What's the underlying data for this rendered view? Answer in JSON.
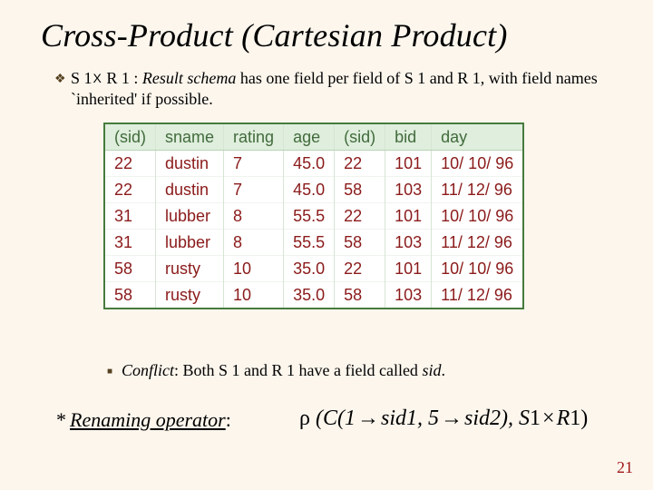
{
  "title": "Cross-Product (Cartesian Product)",
  "bullet1": {
    "pre": "S 1",
    "cross": "X",
    "post": " R 1 :  ",
    "result_schema": "Result schema",
    "tail": " has one field per field of S 1 and R 1, with field names `inherited' if possible."
  },
  "table": {
    "headers": [
      "(sid)",
      "sname",
      "rating",
      "age",
      "(sid)",
      "bid",
      "day"
    ],
    "rows": [
      [
        "22",
        "dustin",
        "7",
        "45.0",
        "22",
        "101",
        "10/ 10/ 96"
      ],
      [
        "22",
        "dustin",
        "7",
        "45.0",
        "58",
        "103",
        "11/ 12/ 96"
      ],
      [
        "31",
        "lubber",
        "8",
        "55.5",
        "22",
        "101",
        "10/ 10/ 96"
      ],
      [
        "31",
        "lubber",
        "8",
        "55.5",
        "58",
        "103",
        "11/ 12/ 96"
      ],
      [
        "58",
        "rusty",
        "10",
        "35.0",
        "22",
        "101",
        "10/ 10/ 96"
      ],
      [
        "58",
        "rusty",
        "10",
        "35.0",
        "58",
        "103",
        "11/ 12/ 96"
      ]
    ]
  },
  "bullet2": {
    "conflict": "Conflict",
    "tail": ":  Both S 1 and R 1 have a field called ",
    "sid": "sid",
    "dot": "."
  },
  "footnote": {
    "star": "*",
    "label": "Renaming operator",
    "colon": ":"
  },
  "formula": {
    "rho": "ρ",
    "open": " (",
    "C": "C",
    "p1": "(1",
    "arrow": "→",
    "sid1": "sid",
    "one": "1, 5",
    "sid2": "sid",
    "two": "2), ",
    "S1": "S",
    "s1n": "1",
    "times": "×",
    "R1": "R",
    "r1n": "1)"
  },
  "pagenum": "21",
  "chart_data": {
    "type": "table",
    "title": "Cross-Product S1 × R1",
    "columns": [
      "(sid)",
      "sname",
      "rating",
      "age",
      "(sid)",
      "bid",
      "day"
    ],
    "rows": [
      [
        22,
        "dustin",
        7,
        45.0,
        22,
        101,
        "10/10/96"
      ],
      [
        22,
        "dustin",
        7,
        45.0,
        58,
        103,
        "11/12/96"
      ],
      [
        31,
        "lubber",
        8,
        55.5,
        22,
        101,
        "10/10/96"
      ],
      [
        31,
        "lubber",
        8,
        55.5,
        58,
        103,
        "11/12/96"
      ],
      [
        58,
        "rusty",
        10,
        35.0,
        22,
        101,
        "10/10/96"
      ],
      [
        58,
        "rusty",
        10,
        35.0,
        58,
        103,
        "11/12/96"
      ]
    ]
  }
}
